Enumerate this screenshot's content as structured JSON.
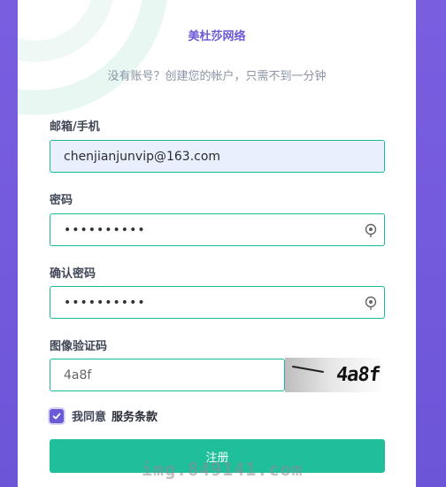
{
  "brand": {
    "name": "美杜莎网络"
  },
  "subtitle": "没有账号？创建您的帐户，只需不到一分钟",
  "form": {
    "email_label": "邮箱/手机",
    "email_value": "chenjianjunvip@163.com",
    "password_label": "密码",
    "password_value": "••••••••••",
    "confirm_label": "确认密码",
    "confirm_value": "••••••••••",
    "captcha_label": "图像验证码",
    "captcha_value": "4a8f",
    "captcha_image_text": "4a8f",
    "agree_text": "我同意",
    "terms_link": "服务条款",
    "agree_checked": true,
    "submit_label": "注册"
  },
  "icons": {
    "eye": "eye-icon",
    "checkmark": "checkmark-icon"
  },
  "colors": {
    "accent": "#6a5ad6",
    "primary": "#1fbf9c",
    "border": "#19b99a",
    "autofill": "#e8f0fe"
  },
  "watermark": "img.849141.com"
}
